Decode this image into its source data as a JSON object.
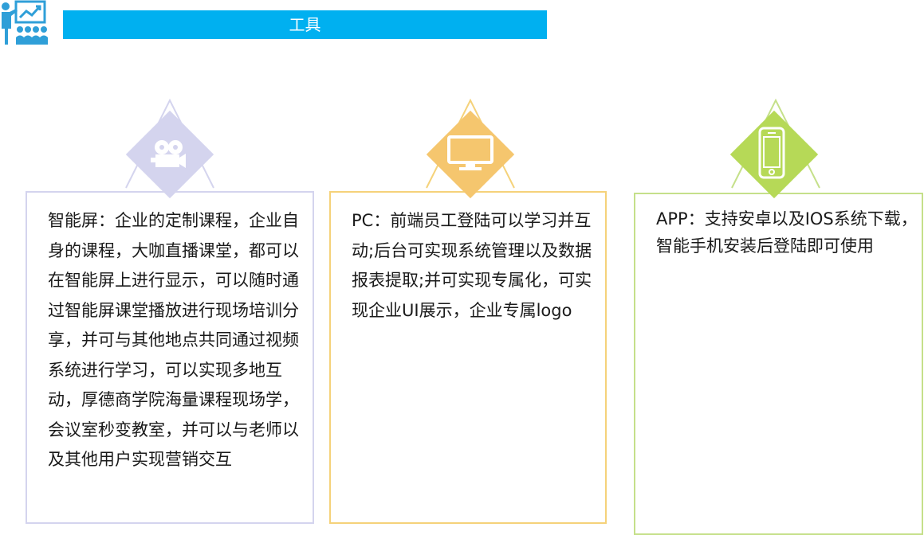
{
  "header": {
    "title": "工具",
    "logo_icon": "presenter-chart-icon",
    "bar_color": "#00b0f0"
  },
  "cards": [
    {
      "icon": "movie-camera-icon",
      "accent_color": "#d4d4ee",
      "text": "智能屏：企业的定制课程，企业自身的课程，大咖直播课堂，都可以在智能屏上进行显示，可以随时通过智能屏课堂播放进行现场培训分享，并可与其他地点共同通过视频系统进行学习，可以实现多地互动，厚德商学院海量课程现场学，会议室秒变教室，并可以与老师以及其他用户实现营销交互"
    },
    {
      "icon": "monitor-icon",
      "accent_color": "#f5c66e",
      "text": "PC：前端员工登陆可以学习并互动;后台可实现系统管理以及数据报表提取;并可实现专属化，可实现企业UI展示，企业专属logo"
    },
    {
      "icon": "smartphone-icon",
      "accent_color": "#b6d957",
      "text": "APP：支持安卓以及IOS系统下载，智能手机安装后登陆即可使用"
    }
  ]
}
